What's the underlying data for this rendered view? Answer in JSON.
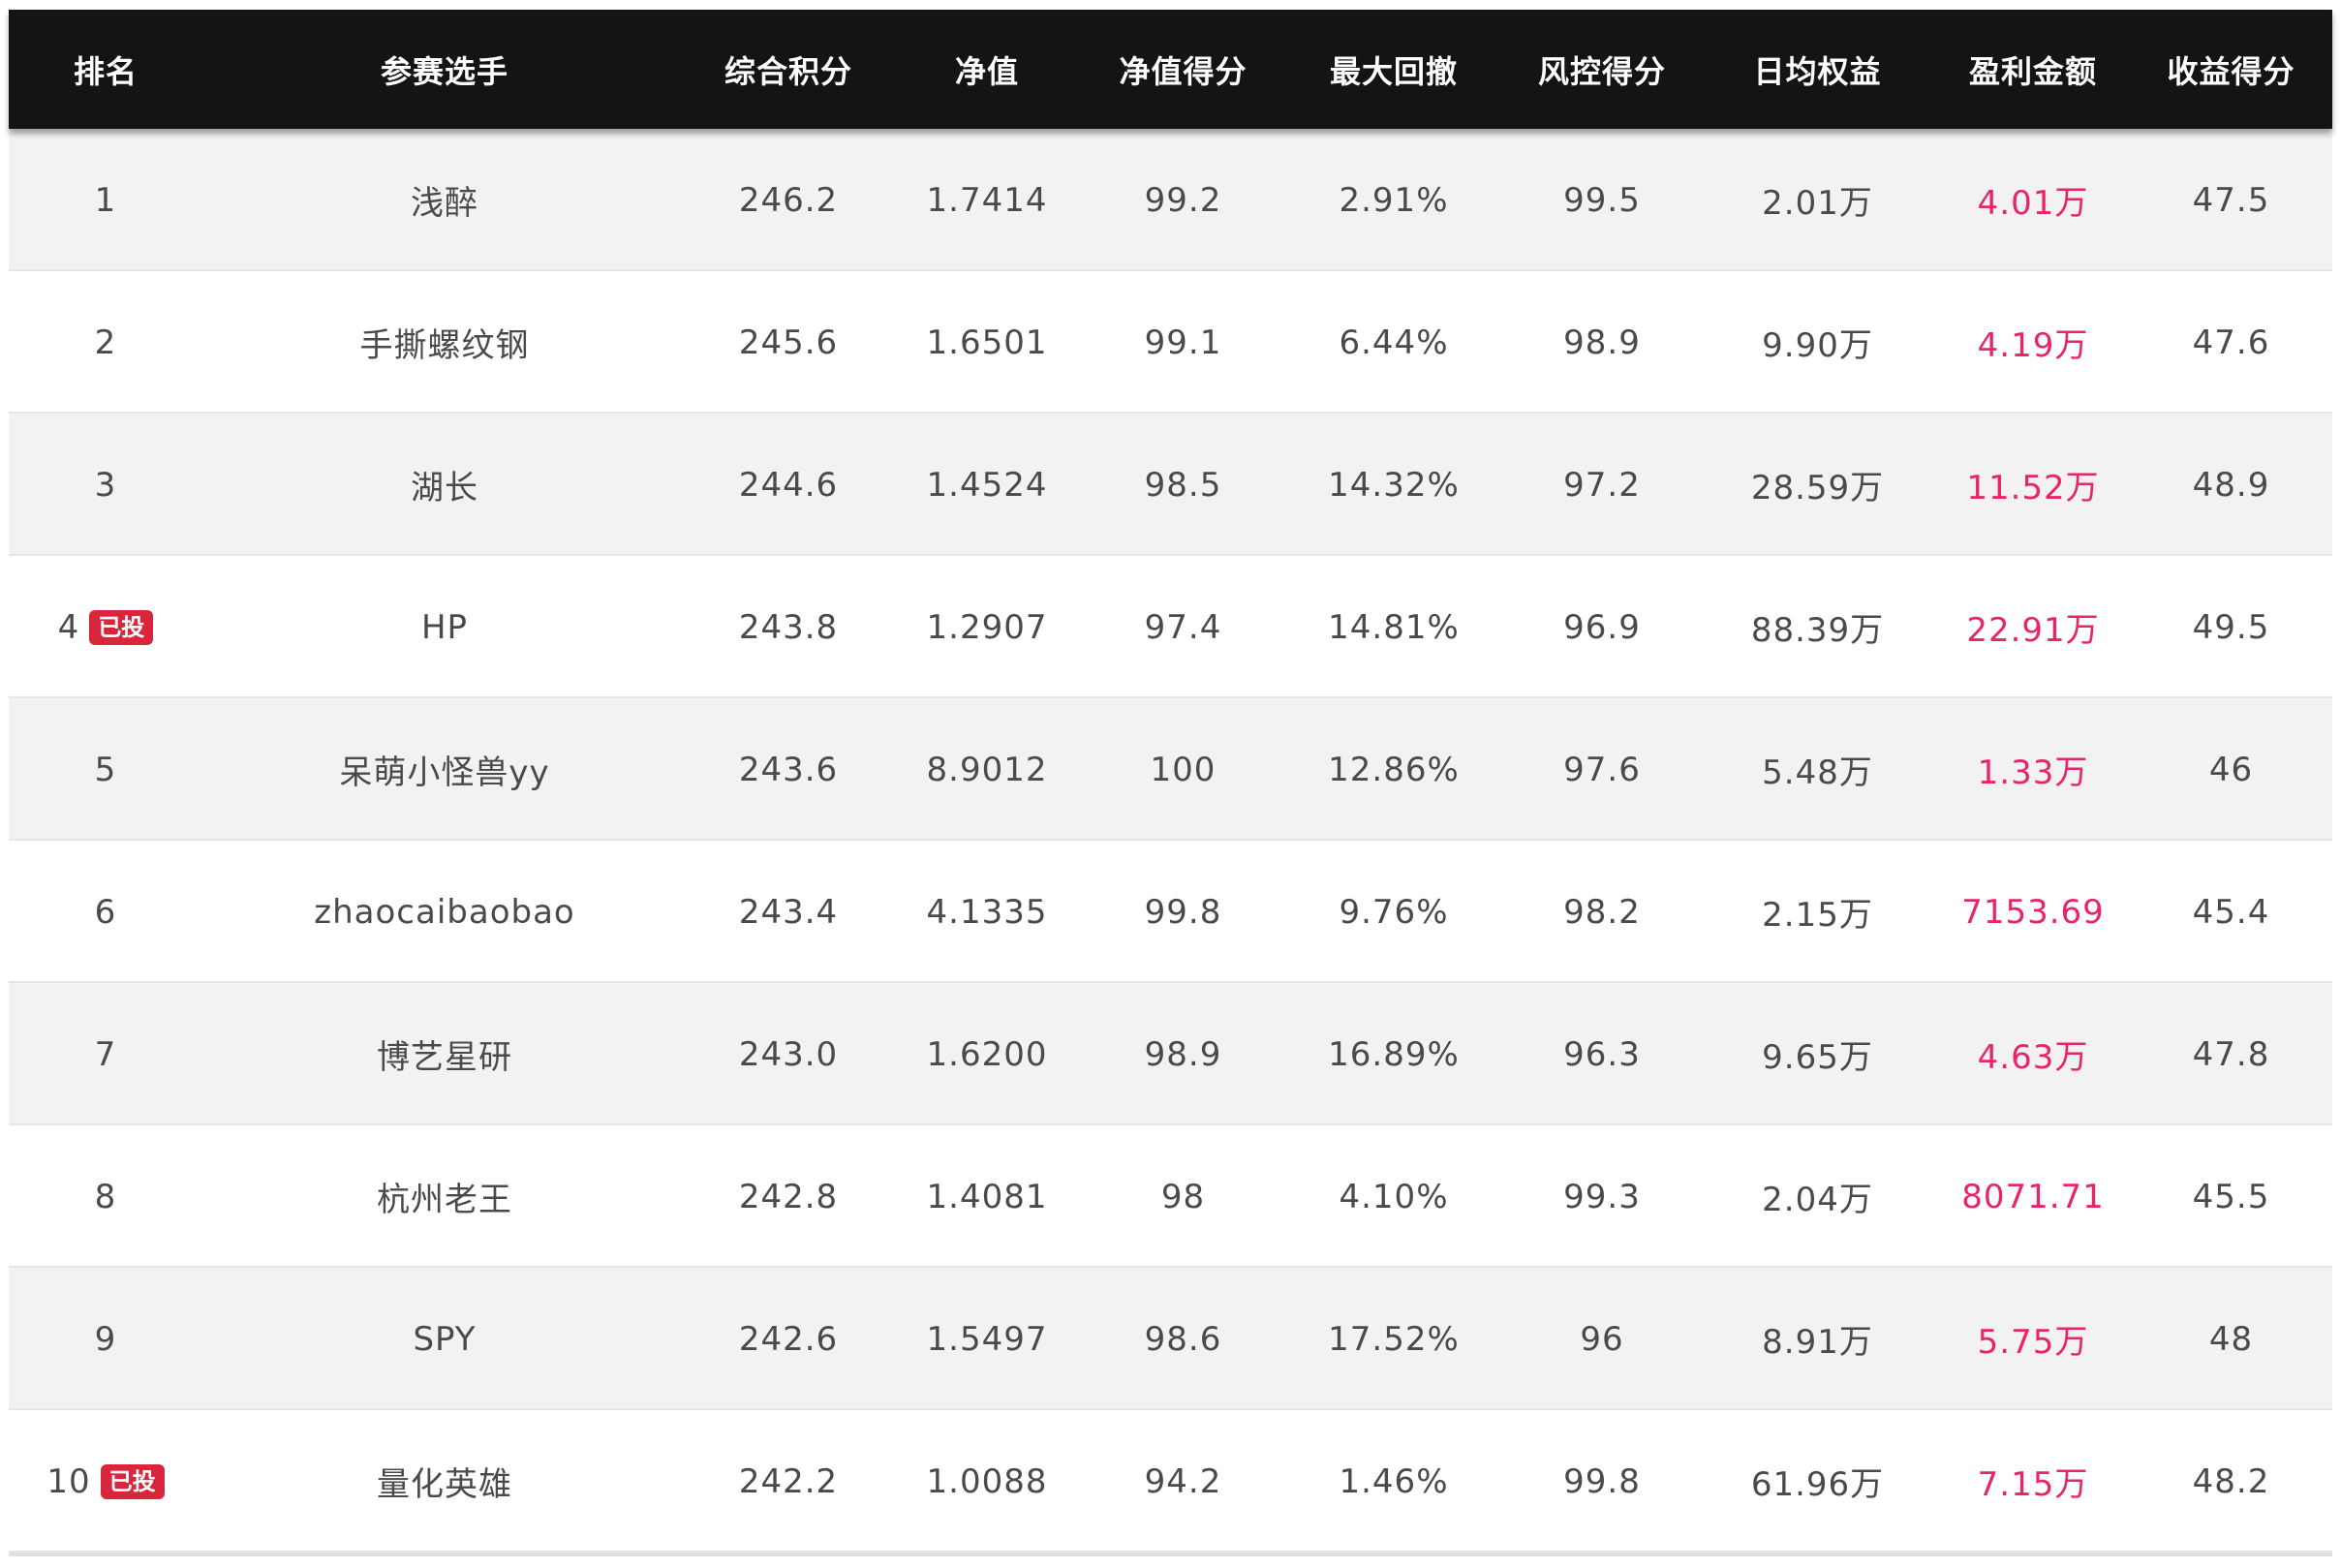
{
  "headers": [
    "排名",
    "参赛选手",
    "综合积分",
    "净值",
    "净值得分",
    "最大回撤",
    "风控得分",
    "日均权益",
    "盈利金额",
    "收益得分"
  ],
  "colors": {
    "header_bg": "#141414",
    "profit": "#e8246a",
    "badge": "#d9263d"
  },
  "rows": [
    {
      "rank": "1",
      "badge": "",
      "player": "浅醉",
      "score": "246.2",
      "nav": "1.7414",
      "nav_score": "99.2",
      "max_drawdown": "2.91%",
      "risk_score": "99.5",
      "avg_equity": "2.01万",
      "profit": "4.01万",
      "return_score": "47.5"
    },
    {
      "rank": "2",
      "badge": "",
      "player": "手撕螺纹钢",
      "score": "245.6",
      "nav": "1.6501",
      "nav_score": "99.1",
      "max_drawdown": "6.44%",
      "risk_score": "98.9",
      "avg_equity": "9.90万",
      "profit": "4.19万",
      "return_score": "47.6"
    },
    {
      "rank": "3",
      "badge": "",
      "player": "湖长",
      "score": "244.6",
      "nav": "1.4524",
      "nav_score": "98.5",
      "max_drawdown": "14.32%",
      "risk_score": "97.2",
      "avg_equity": "28.59万",
      "profit": "11.52万",
      "return_score": "48.9"
    },
    {
      "rank": "4",
      "badge": "已投",
      "player": "HP",
      "score": "243.8",
      "nav": "1.2907",
      "nav_score": "97.4",
      "max_drawdown": "14.81%",
      "risk_score": "96.9",
      "avg_equity": "88.39万",
      "profit": "22.91万",
      "return_score": "49.5"
    },
    {
      "rank": "5",
      "badge": "",
      "player": "呆萌小怪兽yy",
      "score": "243.6",
      "nav": "8.9012",
      "nav_score": "100",
      "max_drawdown": "12.86%",
      "risk_score": "97.6",
      "avg_equity": "5.48万",
      "profit": "1.33万",
      "return_score": "46"
    },
    {
      "rank": "6",
      "badge": "",
      "player": "zhaocaibaobao",
      "score": "243.4",
      "nav": "4.1335",
      "nav_score": "99.8",
      "max_drawdown": "9.76%",
      "risk_score": "98.2",
      "avg_equity": "2.15万",
      "profit": "7153.69",
      "return_score": "45.4"
    },
    {
      "rank": "7",
      "badge": "",
      "player": "博艺星研",
      "score": "243.0",
      "nav": "1.6200",
      "nav_score": "98.9",
      "max_drawdown": "16.89%",
      "risk_score": "96.3",
      "avg_equity": "9.65万",
      "profit": "4.63万",
      "return_score": "47.8"
    },
    {
      "rank": "8",
      "badge": "",
      "player": "杭州老王",
      "score": "242.8",
      "nav": "1.4081",
      "nav_score": "98",
      "max_drawdown": "4.10%",
      "risk_score": "99.3",
      "avg_equity": "2.04万",
      "profit": "8071.71",
      "return_score": "45.5"
    },
    {
      "rank": "9",
      "badge": "",
      "player": "SPY",
      "score": "242.6",
      "nav": "1.5497",
      "nav_score": "98.6",
      "max_drawdown": "17.52%",
      "risk_score": "96",
      "avg_equity": "8.91万",
      "profit": "5.75万",
      "return_score": "48"
    },
    {
      "rank": "10",
      "badge": "已投",
      "player": "量化英雄",
      "score": "242.2",
      "nav": "1.0088",
      "nav_score": "94.2",
      "max_drawdown": "1.46%",
      "risk_score": "99.8",
      "avg_equity": "61.96万",
      "profit": "7.15万",
      "return_score": "48.2"
    }
  ]
}
